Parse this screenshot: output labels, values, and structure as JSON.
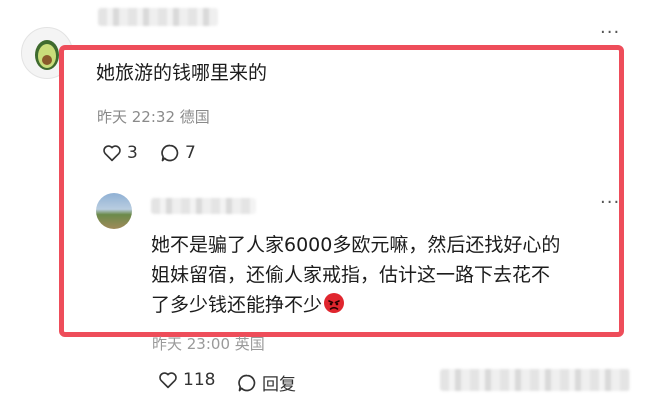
{
  "comment": {
    "text": "她旅游的钱哪里来的",
    "time": "昨天 22:32",
    "location": "德国",
    "likes": "3",
    "replies": "7"
  },
  "reply": {
    "text_line1": "她不是骗了人家6000多欧元嘛，然后还找好心的",
    "text_line2": "姐妹留宿，还偷人家戒指，估计这一路下去花不",
    "text_line3": "了多少钱还能挣不少",
    "emoji": "angry-face-emoji"
  },
  "partial_meta": {
    "time": "昨天 23:00",
    "location": "英国"
  },
  "footer": {
    "likes": "118",
    "reply_label": "回复"
  },
  "colors": {
    "highlight_border": "#ee4d5a",
    "meta_text": "#8a8a8a"
  }
}
